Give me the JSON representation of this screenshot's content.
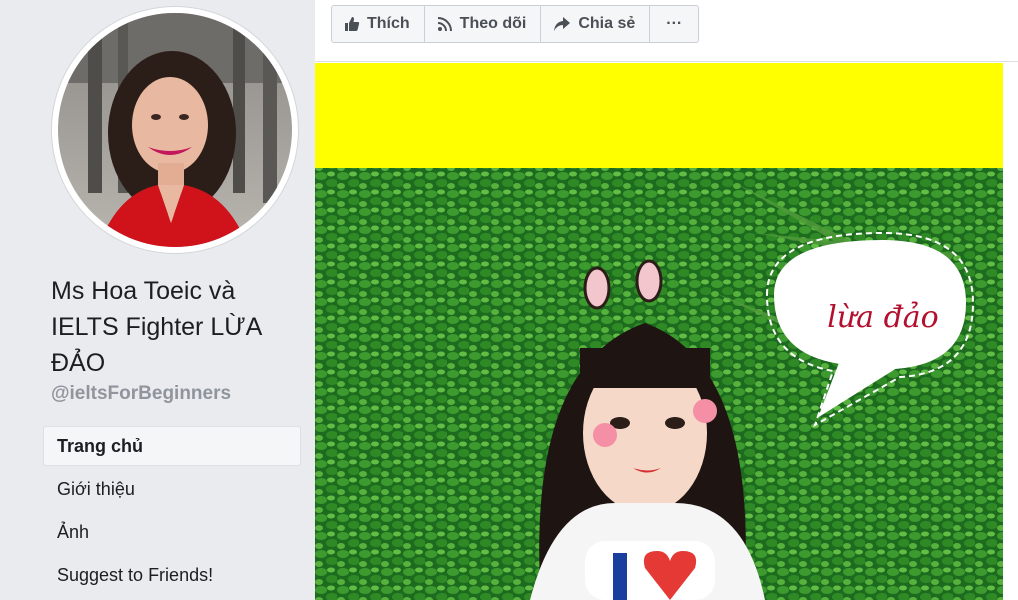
{
  "page": {
    "name": "Ms Hoa Toeic và IELTS Fighter LỪA ĐẢO",
    "handle": "@ieltsForBeginners"
  },
  "nav": {
    "items": [
      {
        "label": "Trang chủ",
        "active": true
      },
      {
        "label": "Giới thiệu",
        "active": false
      },
      {
        "label": "Ảnh",
        "active": false
      },
      {
        "label": "Suggest to Friends!",
        "active": false
      }
    ]
  },
  "toolbar": {
    "like_label": "Thích",
    "follow_label": "Theo dõi",
    "share_label": "Chia sẻ",
    "more_label": "···"
  },
  "cover": {
    "bubble_text": "lừa đảo",
    "banner_color": "#ffff00",
    "bubble_text_color": "#b2102e"
  },
  "colors": {
    "background": "#e9ebee",
    "toolbar_text": "#4b4f56"
  }
}
